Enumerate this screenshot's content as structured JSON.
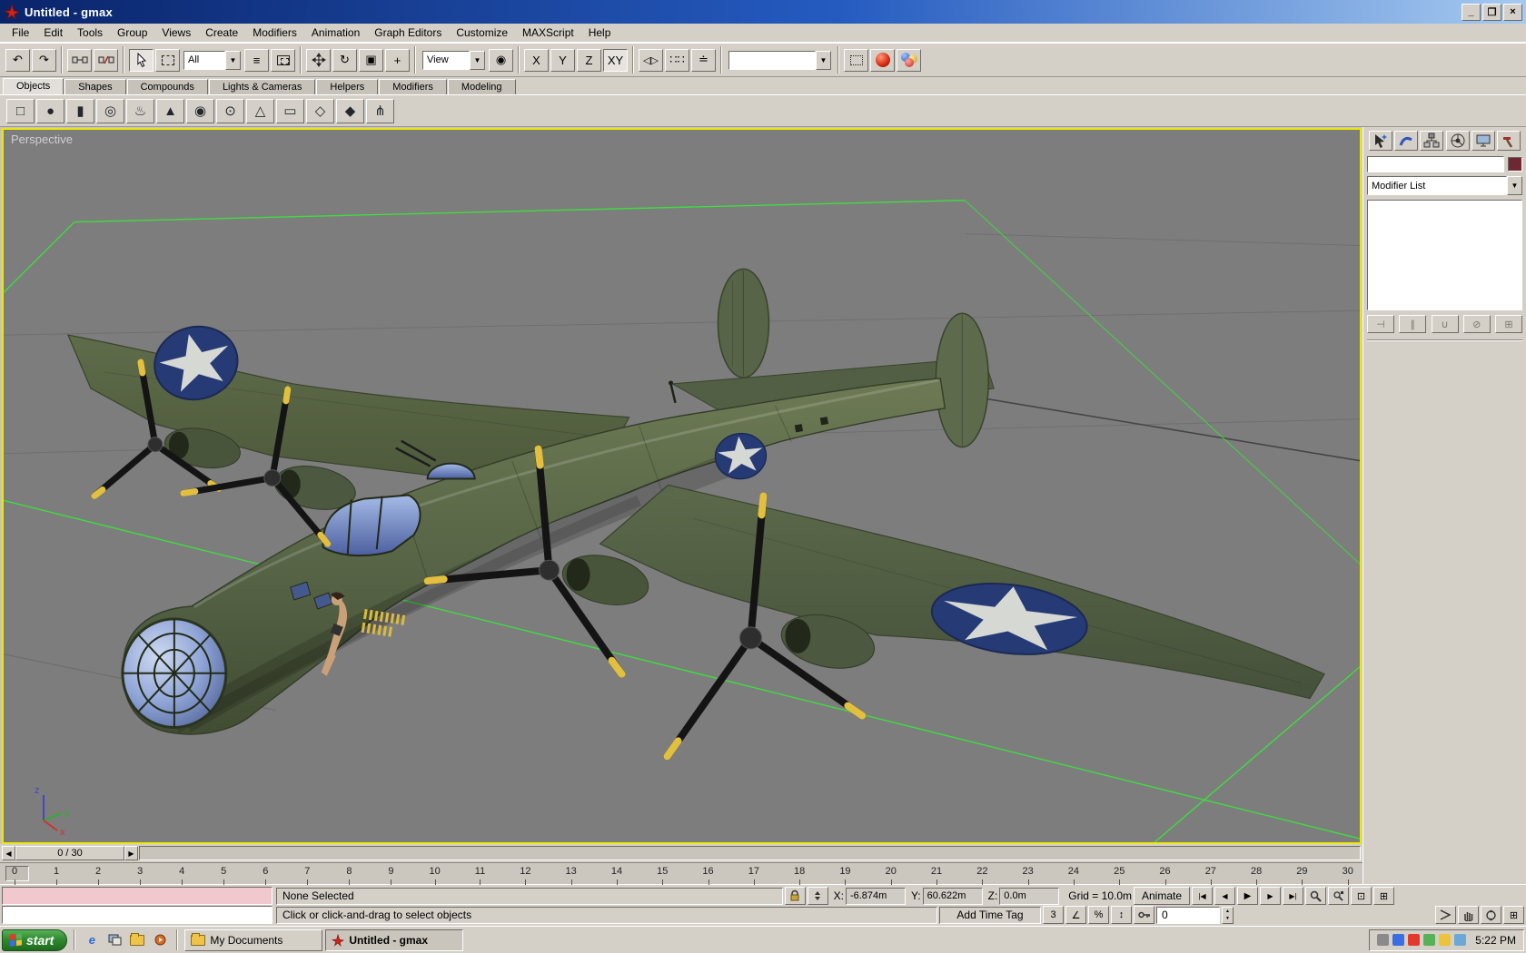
{
  "titlebar": {
    "title": "Untitled - gmax",
    "controls": {
      "minimize": "_",
      "maximize": "❒",
      "close": "×"
    }
  },
  "menu": {
    "items": [
      "File",
      "Edit",
      "Tools",
      "Group",
      "Views",
      "Create",
      "Modifiers",
      "Animation",
      "Graph Editors",
      "Customize",
      "MAXScript",
      "Help"
    ]
  },
  "toolbar": {
    "selection_filter": "All",
    "coord_system": "View",
    "axis_x": "X",
    "axis_y": "Y",
    "axis_z": "Z",
    "axis_xy": "XY",
    "named_selection": ""
  },
  "tabs": {
    "items": [
      {
        "label": "Objects",
        "active": true
      },
      {
        "label": "Shapes",
        "active": false
      },
      {
        "label": "Compounds",
        "active": false
      },
      {
        "label": "Lights & Cameras",
        "active": false
      },
      {
        "label": "Helpers",
        "active": false
      },
      {
        "label": "Modifiers",
        "active": false
      },
      {
        "label": "Modeling",
        "active": false
      }
    ]
  },
  "object_toolbar": {
    "tools": [
      "Box",
      "Sphere",
      "Cylinder",
      "Torus",
      "Teapot",
      "Cone",
      "GeoSphere",
      "Tube",
      "Pyramid",
      "Plane",
      "Quad Patch",
      "Tri Patch",
      "Bones"
    ]
  },
  "viewport": {
    "label": "Perspective",
    "axis": {
      "x": "x",
      "y": "y",
      "z": "z"
    }
  },
  "command_panel": {
    "object_name": "",
    "modifier_list": "Modifier List"
  },
  "timeline": {
    "slider_label": "0 / 30",
    "ticks": [
      "0",
      "1",
      "2",
      "3",
      "4",
      "5",
      "6",
      "7",
      "8",
      "9",
      "10",
      "11",
      "12",
      "13",
      "14",
      "15",
      "16",
      "17",
      "18",
      "19",
      "20",
      "21",
      "22",
      "23",
      "24",
      "25",
      "26",
      "27",
      "28",
      "29",
      "30"
    ]
  },
  "status": {
    "selection": "None Selected",
    "prompt": "Click or click-and-drag to select objects",
    "add_time_tag": "Add Time Tag",
    "x_label": "X:",
    "x_value": "-6.874m",
    "y_label": "Y:",
    "y_value": "60.622m",
    "z_label": "Z:",
    "z_value": "0.0m",
    "grid": "Grid = 10.0m",
    "animate": "Animate",
    "frame": "0"
  },
  "playback": {
    "go_start": "|◀",
    "prev": "◀",
    "play": "▶",
    "next": "▶",
    "go_end": "▶|"
  },
  "snaps": {
    "snap3d": "3",
    "angle": "∠",
    "percent": "%",
    "spinner": "↕"
  },
  "icons": {
    "dropdown": "▼",
    "undo": "↶",
    "redo": "↷",
    "rotate": "↻",
    "scale": "▣",
    "manipulate": "+",
    "select_by_name": "≡",
    "mirror": "◁▷",
    "array": "∷∷",
    "align": "≐",
    "pivot": "◉",
    "slider_left": "◀",
    "slider_right": "▶",
    "box": "□",
    "sphere": "●",
    "cylinder": "▮",
    "torus": "◎",
    "teapot": "♨",
    "cone": "▲",
    "geosphere": "◉",
    "tube": "⊙",
    "pyramid": "△",
    "plane": "▭",
    "quadpatch": "◇",
    "tripatch": "◆",
    "bones": "⋔",
    "pin": "⊣",
    "show_end": "∥",
    "make_unique": "∪",
    "remove": "⊘",
    "configure": "⊞",
    "zoom_extents": "⊡",
    "zoom_extents_all": "⊞",
    "minmax": "⊞"
  },
  "colors": {
    "viewport_bg": "#7d7d7d",
    "grid_green": "#3fdc3f",
    "viewport_border": "#ece70b",
    "olive": "#566345",
    "insignia_blue": "#263a75",
    "chrome": "#d4d0c8"
  },
  "taskbar": {
    "start": "start",
    "tasks": [
      {
        "label": "My Documents",
        "active": false
      },
      {
        "label": "Untitled - gmax",
        "active": true
      }
    ],
    "clock": "5:22 PM"
  }
}
